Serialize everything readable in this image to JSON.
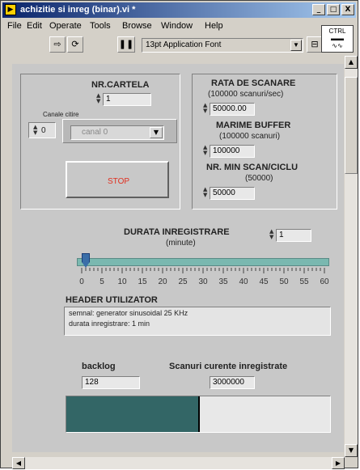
{
  "window": {
    "title": "achizitie si inreg (binar).vi *",
    "minimize": "_",
    "maximize": "□",
    "close": "X"
  },
  "menu": [
    "File",
    "Edit",
    "Operate",
    "Tools",
    "Browse",
    "Window",
    "Help"
  ],
  "toolbar": {
    "font_selector": "13pt Application Font"
  },
  "panel": {
    "nr_cartela_label": "NR.CARTELA",
    "nr_cartela_value": "1",
    "canale_label": "Canale citire",
    "channel_index": "0",
    "channel_name": "canal 0",
    "stop_label": "STOP",
    "rata_label": "RATA DE SCANARE",
    "rata_sub": "(100000 scanuri/sec)",
    "rata_value": "50000.00",
    "marime_label": "MARIME BUFFER",
    "marime_sub": "(100000 scanuri)",
    "marime_value": "100000",
    "nrmin_label": "NR. MIN SCAN/CICLU",
    "nrmin_sub": "(50000)",
    "nrmin_value": "50000",
    "durata_label": "DURATA INREGISTRARE",
    "durata_sub": "(minute)",
    "durata_value": "1",
    "slider_ticks": [
      "0",
      "5",
      "10",
      "15",
      "20",
      "25",
      "30",
      "35",
      "40",
      "45",
      "50",
      "55",
      "60"
    ],
    "slider_value": 1,
    "slider_max": 60,
    "header_label": "HEADER UTILIZATOR",
    "header_line1": "semnal: generator sinusoidal 25 KHz",
    "header_line2": "durata inregistrare: 1 min",
    "backlog_label": "backlog",
    "backlog_value": "128",
    "scanuri_label": "Scanuri curente inregistrate",
    "scanuri_value": "3000000",
    "progress_fraction": 0.5,
    "progress_color": "#336666"
  }
}
